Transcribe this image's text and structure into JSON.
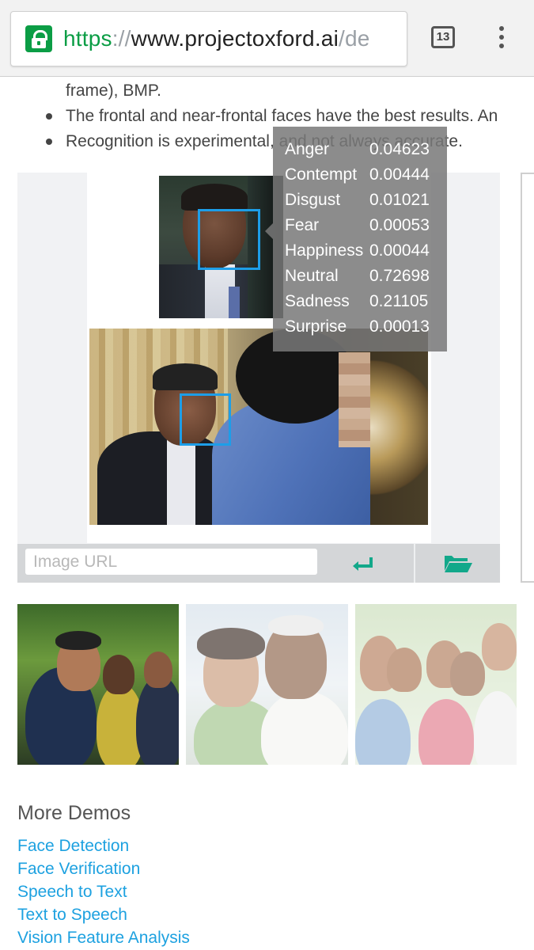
{
  "browser": {
    "url_scheme": "https",
    "url_sep": "://",
    "url_host": "www.projectoxford.ai",
    "url_path": "/de",
    "tab_count": "13"
  },
  "page": {
    "line_frame": "frame), BMP.",
    "bullet1": "The frontal and near-frontal faces have the best results. An",
    "bullet2": "Recognition is experimental, and not always accurate."
  },
  "emotion_scores": [
    {
      "label": "Anger",
      "value": "0.04623"
    },
    {
      "label": "Contempt",
      "value": "0.00444"
    },
    {
      "label": "Disgust",
      "value": "0.01021"
    },
    {
      "label": "Fear",
      "value": "0.00053"
    },
    {
      "label": "Happiness",
      "value": "0.00044"
    },
    {
      "label": "Neutral",
      "value": "0.72698"
    },
    {
      "label": "Sadness",
      "value": "0.21105"
    },
    {
      "label": "Surprise",
      "value": "0.00013"
    }
  ],
  "input": {
    "placeholder": "Image URL"
  },
  "icons": {
    "enter": "enter-arrow-icon",
    "folder": "folder-open-icon",
    "lock": "lock-icon",
    "menu": "more-vert-icon"
  },
  "colors": {
    "accent_green": "#0b9d45",
    "link_blue": "#1da1e0",
    "face_box": "#1d9ee8",
    "button_teal": "#12a88a"
  },
  "more_demos": {
    "title": "More Demos",
    "links": [
      "Face Detection",
      "Face Verification",
      "Speech to Text",
      "Text to Speech",
      "Vision Feature Analysis"
    ]
  }
}
